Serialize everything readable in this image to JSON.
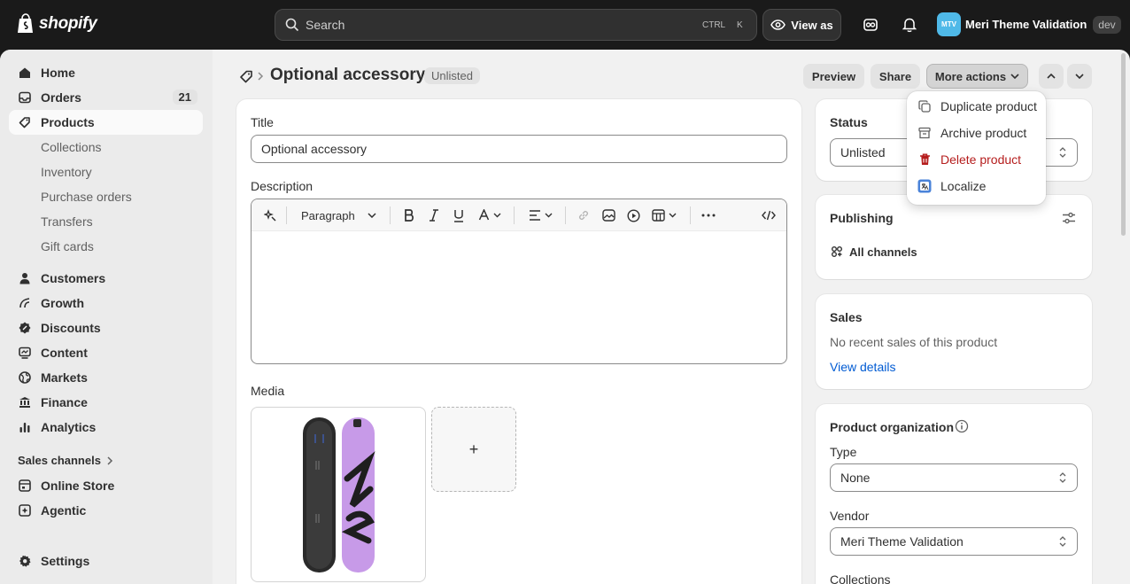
{
  "topbar": {
    "logo_text": "shopify",
    "search_placeholder": "Search",
    "shortcut_ctrl": "CTRL",
    "shortcut_k": "K",
    "view_as_label": "View as",
    "store_initials": "MTV",
    "store_name": "Meri Theme Validation",
    "store_badge": "dev"
  },
  "sidebar": {
    "items": [
      {
        "label": "Home",
        "icon": "home-icon"
      },
      {
        "label": "Orders",
        "icon": "orders-icon",
        "count": "21"
      },
      {
        "label": "Products",
        "icon": "tag-icon",
        "active": true
      },
      {
        "label": "Collections"
      },
      {
        "label": "Inventory"
      },
      {
        "label": "Purchase orders"
      },
      {
        "label": "Transfers"
      },
      {
        "label": "Gift cards"
      },
      {
        "label": "Customers",
        "icon": "person-icon"
      },
      {
        "label": "Growth",
        "icon": "growth-icon"
      },
      {
        "label": "Discounts",
        "icon": "discount-icon"
      },
      {
        "label": "Content",
        "icon": "content-icon"
      },
      {
        "label": "Markets",
        "icon": "globe-icon"
      },
      {
        "label": "Finance",
        "icon": "finance-icon"
      },
      {
        "label": "Analytics",
        "icon": "analytics-icon"
      }
    ],
    "sales_channels_label": "Sales channels",
    "channels": [
      {
        "label": "Online Store",
        "icon": "store-icon"
      },
      {
        "label": "Agentic",
        "icon": "agentic-icon"
      }
    ],
    "settings_label": "Settings"
  },
  "header": {
    "title": "Optional accessory",
    "status_badge": "Unlisted",
    "preview_label": "Preview",
    "share_label": "Share",
    "more_actions_label": "More actions"
  },
  "more_actions_menu": [
    {
      "label": "Duplicate product",
      "icon": "duplicate-icon"
    },
    {
      "label": "Archive product",
      "icon": "archive-icon"
    },
    {
      "label": "Delete product",
      "icon": "trash-icon",
      "tone": "critical",
      "color": "#b51d1d"
    },
    {
      "label": "Localize",
      "icon": "localize-icon"
    }
  ],
  "product_form": {
    "title_label": "Title",
    "title_value": "Optional accessory",
    "description_label": "Description",
    "paragraph_label": "Paragraph",
    "media_label": "Media",
    "media_add_symbol": "+"
  },
  "status_card": {
    "heading": "Status",
    "value": "Unlisted"
  },
  "publishing_card": {
    "heading": "Publishing",
    "channels_label": "All channels"
  },
  "sales_card": {
    "heading": "Sales",
    "text": "No recent sales of this product",
    "link": "View details"
  },
  "organization_card": {
    "heading": "Product organization",
    "type_label": "Type",
    "type_value": "None",
    "vendor_label": "Vendor",
    "vendor_value": "Meri Theme Validation",
    "collections_label": "Collections"
  },
  "colors": {
    "link": "#005bd3",
    "critical": "#b51d1d",
    "avatar": "#4fb9e8"
  }
}
